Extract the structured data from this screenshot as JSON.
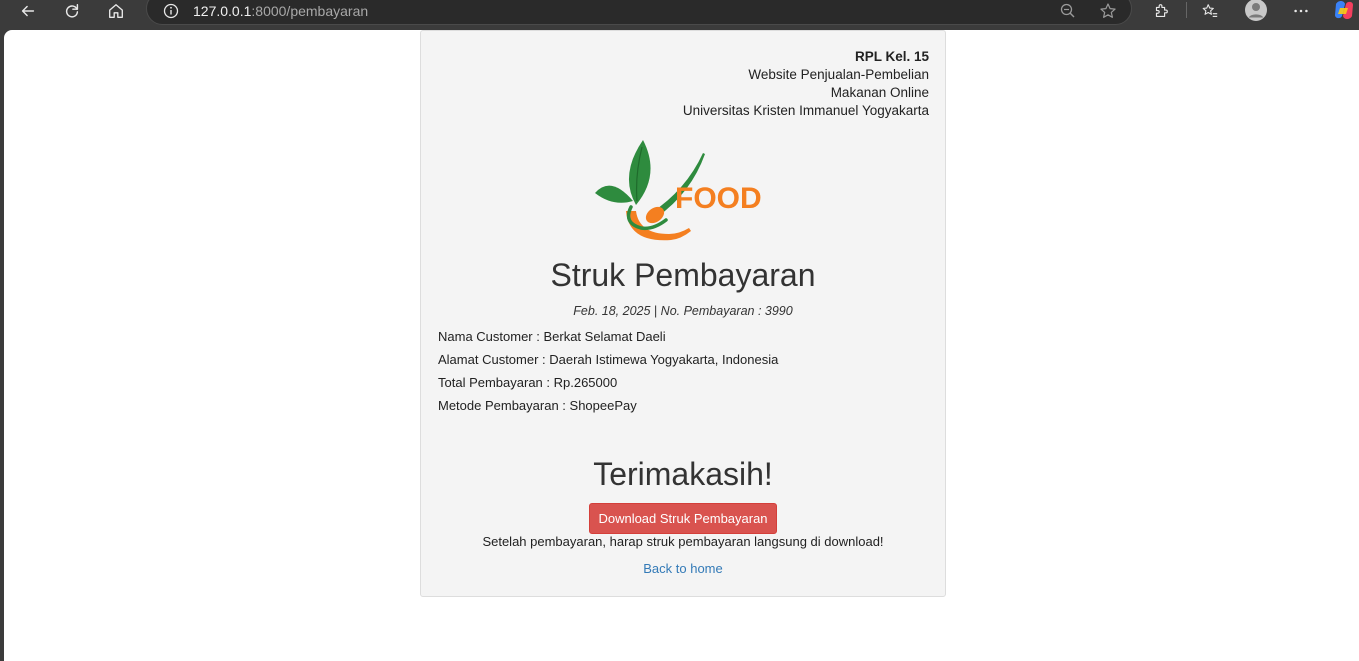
{
  "browser": {
    "url_host": "127.0.0.1",
    "url_rest": ":8000/pembayaran",
    "icons": [
      "back-icon",
      "refresh-icon",
      "home-icon",
      "info-icon",
      "zoom-icon",
      "star-icon",
      "extensions-icon",
      "favorites-icon",
      "profile-icon",
      "more-icon",
      "copilot-icon"
    ]
  },
  "header": {
    "group": "RPL Kel. 15",
    "line1": "Website Penjualan-Pembelian",
    "line2": "Makanan Online",
    "line3": "Universitas Kristen Immanuel Yogyakarta"
  },
  "logo": {
    "text": "FOOD",
    "colors": {
      "green": "#2e8b3e",
      "orange": "#f47f20"
    }
  },
  "receipt": {
    "title": "Struk Pembayaran",
    "date": "Feb. 18, 2025",
    "separator": "|",
    "number_label": "No. Pembayaran : 3990",
    "fields": [
      "Nama Customer : Berkat Selamat Daeli",
      "Alamat Customer : Daerah Istimewa Yogyakarta, Indonesia",
      "Total Pembayaran : Rp.265000",
      "Metode Pembayaran : ShopeePay"
    ]
  },
  "footer": {
    "thanks": "Terimakasih!",
    "download_label": "Download Struk Pembayaran",
    "note": "Setelah pembayaran, harap struk pembayaran langsung di download!",
    "back_label": "Back to home"
  },
  "colors": {
    "button": "#d9534f",
    "link": "#337ab7",
    "card": "#f4f4f4"
  }
}
